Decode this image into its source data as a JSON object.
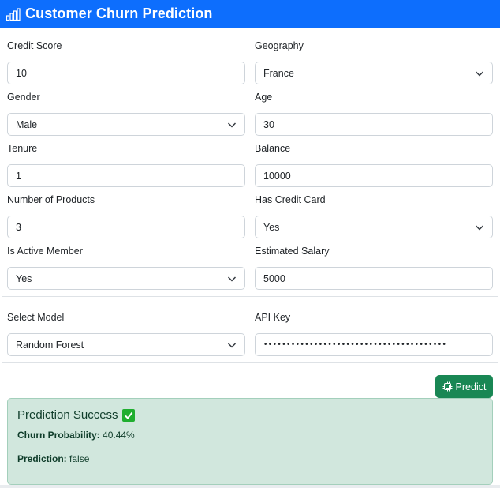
{
  "header": {
    "title": "Customer Churn Prediction",
    "logo_icon": "bar-chart-icon"
  },
  "form": {
    "credit_score": {
      "label": "Credit Score",
      "value": "10"
    },
    "geography": {
      "label": "Geography",
      "value": "France"
    },
    "gender": {
      "label": "Gender",
      "value": "Male"
    },
    "age": {
      "label": "Age",
      "value": "30"
    },
    "tenure": {
      "label": "Tenure",
      "value": "1"
    },
    "balance": {
      "label": "Balance",
      "value": "10000"
    },
    "num_products": {
      "label": "Number of Products",
      "value": "3"
    },
    "has_credit_card": {
      "label": "Has Credit Card",
      "value": "Yes"
    },
    "is_active_member": {
      "label": "Is Active Member",
      "value": "Yes"
    },
    "estimated_salary": {
      "label": "Estimated Salary",
      "value": "5000"
    }
  },
  "model": {
    "select_label": "Select Model",
    "select_value": "Random Forest",
    "api_key_label": "API Key",
    "api_key_masked": "••••••••••••••••••••••••••••••••••••••••"
  },
  "actions": {
    "predict_label": "Predict",
    "predict_icon": "cpu-icon"
  },
  "result": {
    "title": "Prediction Success",
    "status_icon": "check-icon",
    "probability_label": "Churn Probability:",
    "probability_value": "40.44%",
    "prediction_label": "Prediction:",
    "prediction_value": "false"
  },
  "colors": {
    "header_bg": "#0d6efd",
    "predict_button": "#198754",
    "result_bg": "#d1e7dd",
    "check_icon": "#1fae2f"
  }
}
